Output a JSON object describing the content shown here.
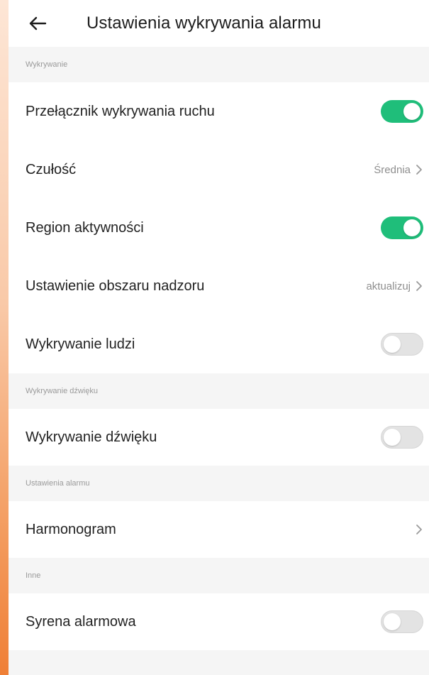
{
  "header": {
    "title": "Ustawienia wykrywania alarmu",
    "back_icon": "arrow-left-icon"
  },
  "sections": {
    "detection": {
      "title": "Wykrywanie",
      "motion_switch": {
        "label": "Przełącznik wykrywania ruchu",
        "state": "on"
      },
      "sensitivity": {
        "label": "Czułość",
        "value": "Średnia"
      },
      "activity_region": {
        "label": "Region aktywności",
        "state": "on"
      },
      "surveillance_area": {
        "label": "Ustawienie obszaru nadzoru",
        "value": "aktualizuj"
      },
      "human_detection": {
        "label": "Wykrywanie ludzi",
        "state": "off"
      }
    },
    "sound": {
      "title": "Wykrywanie dźwięku",
      "sound_detection": {
        "label": "Wykrywanie dźwięku",
        "state": "off"
      }
    },
    "alarm": {
      "title": "Ustawienia alarmu",
      "schedule": {
        "label": "Harmonogram"
      }
    },
    "other": {
      "title": "Inne",
      "siren": {
        "label": "Syrena alarmowa",
        "state": "off"
      }
    }
  },
  "colors": {
    "toggle_on": "#1fbe7a",
    "toggle_off": "#e3e3e3",
    "section_bg": "#f5f5f5",
    "row_bg": "#ffffff"
  }
}
